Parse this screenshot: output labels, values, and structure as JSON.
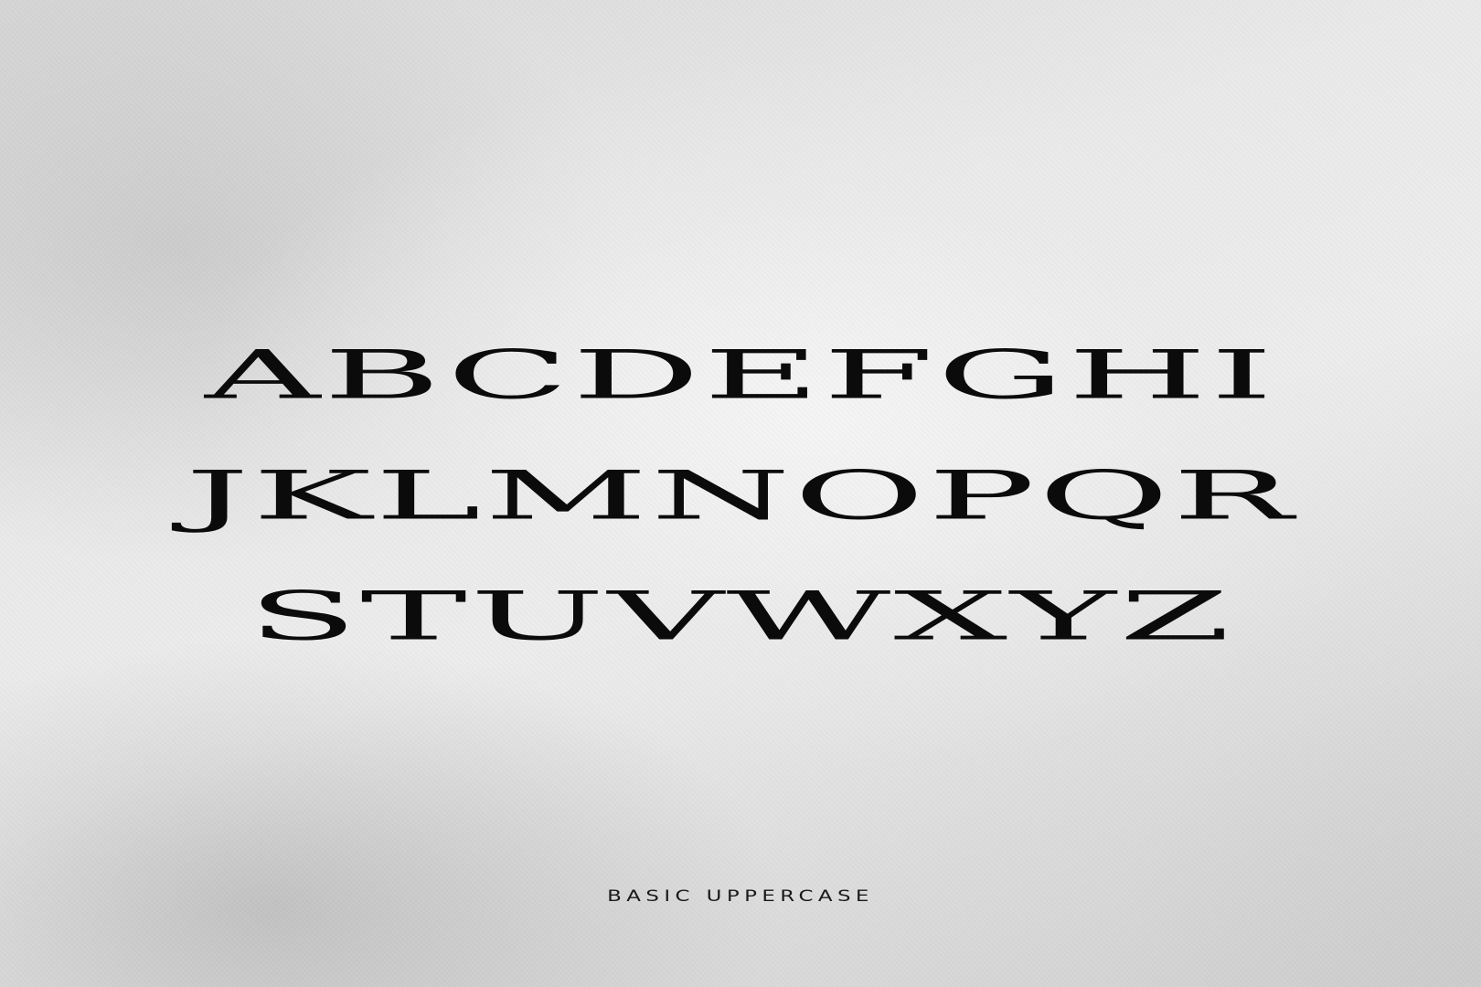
{
  "specimen": {
    "rows": [
      "ABCDEFGHI",
      "JKLMNOPQR",
      "STUVWXYZ"
    ]
  },
  "caption": "BASIC UPPERCASE",
  "colors": {
    "background": "#e6e6e6",
    "glyphs": "#0b0b0b"
  }
}
